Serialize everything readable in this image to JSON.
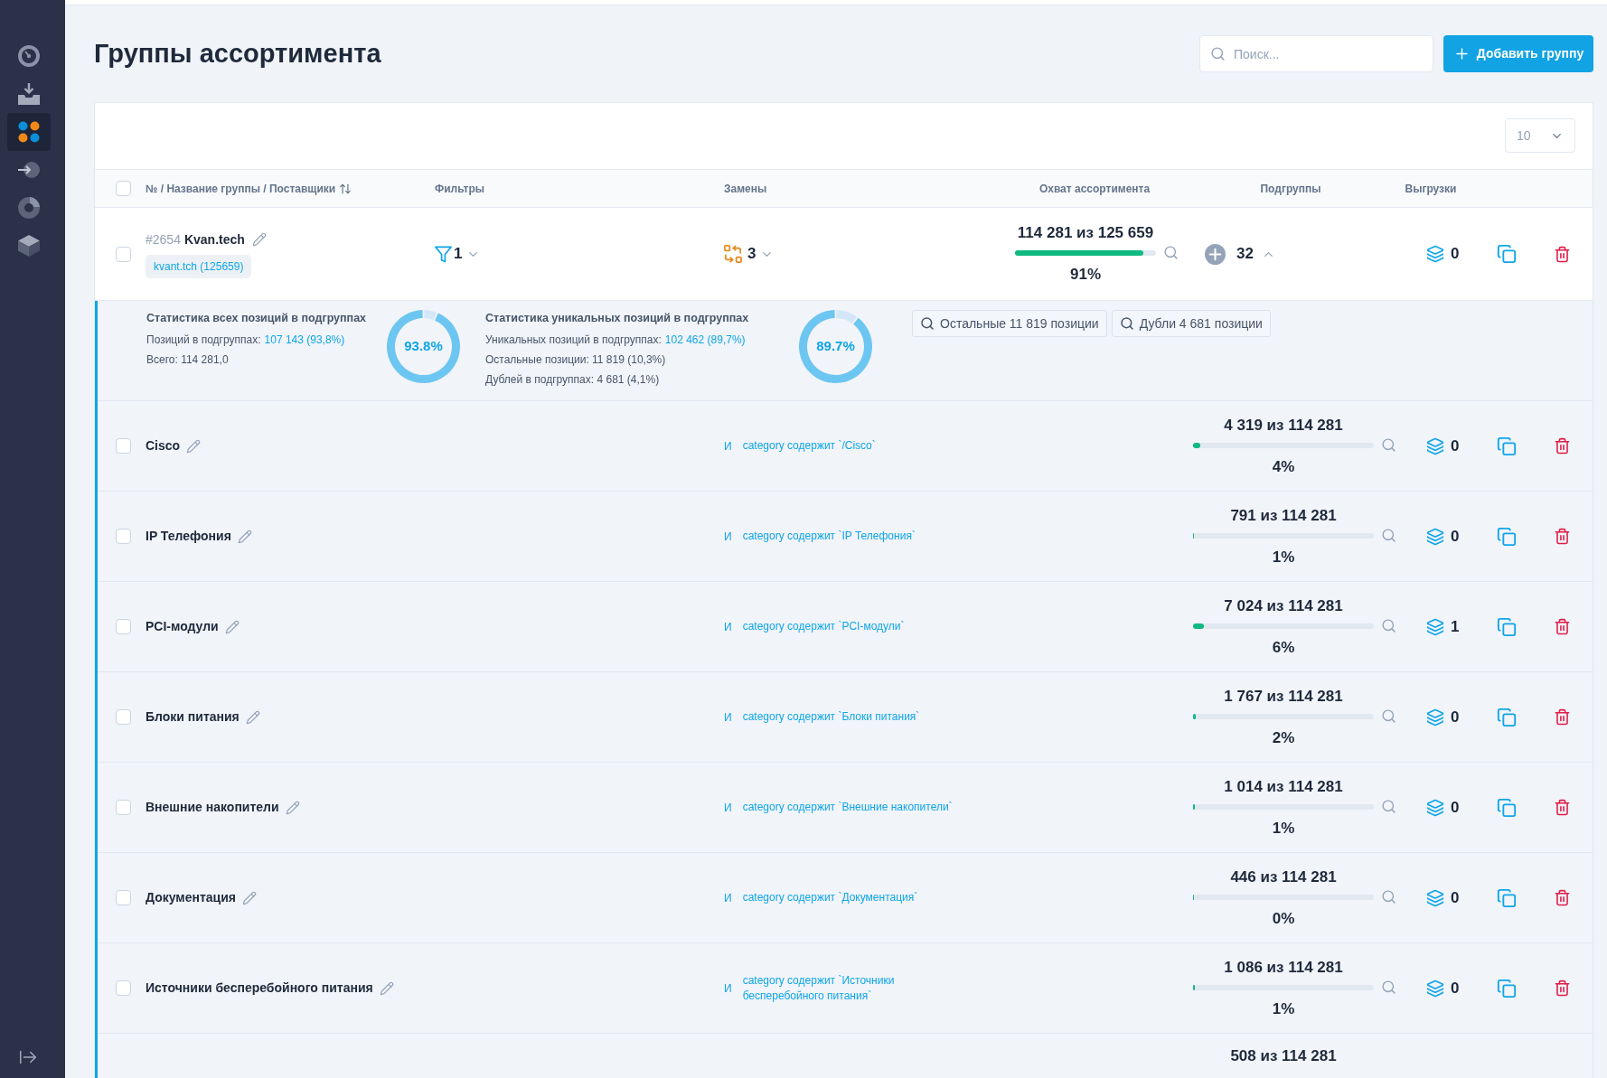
{
  "sidebar": {
    "items": [
      {
        "kind": "gauge",
        "selected": false
      },
      {
        "kind": "inbox",
        "selected": false
      },
      {
        "kind": "dots",
        "selected": true
      },
      {
        "kind": "login",
        "selected": false
      },
      {
        "kind": "pie",
        "selected": false
      },
      {
        "kind": "cube",
        "selected": false
      }
    ]
  },
  "header": {
    "title": "Группы ассортимента",
    "search": {
      "placeholder": "Поиск..."
    },
    "add_button": {
      "label": "Добавить группу"
    }
  },
  "table": {
    "page_size": "10",
    "all_checked": false,
    "columns": [
      {
        "label": "№ / Название группы / Поставщики",
        "sortable": true
      },
      {
        "label": "Фильтры",
        "sortable": false
      },
      {
        "label": "Замены",
        "sortable": false
      },
      {
        "label": "Охват ассортимента",
        "sortable": false
      },
      {
        "label": "Подгруппы",
        "sortable": false
      },
      {
        "label": "Выгрузки",
        "sortable": false
      }
    ],
    "groups": [
      {
        "checked": false,
        "number": "#2654",
        "name": "Kvan.tech",
        "suppliers": [
          "kvant.tch (125659)"
        ],
        "filters": "1",
        "replacements": "3",
        "coverage": {
          "text": "114 281 из 125 659",
          "level": 0.91,
          "percent": "91%"
        },
        "subgroups": {
          "count": "32",
          "expanded": true
        },
        "exports": "0",
        "stats": {
          "blocks": [
            {
              "title": "Статистика всех позиций в подгруппах",
              "lines": [
                {
                  "kind": "link",
                  "label": "Позиций в подгруппах:",
                  "value": "107 143 (93,8%)"
                },
                {
                  "kind": "plain",
                  "text": "Всего: 114 281,0"
                }
              ],
              "ring": {
                "label": "93.8%",
                "chart_data": {
                  "type": "donut",
                  "values": [
                    93.8,
                    6.2
                  ]
                }
              }
            },
            {
              "title": "Статистика уникальных позиций в подгруппах",
              "lines": [
                {
                  "kind": "link",
                  "label": "Уникальных позиций в подгруппах:",
                  "value": "102 462 (89,7%)"
                },
                {
                  "kind": "plain",
                  "text": "Остальные позиции: 11 819 (10,3%)"
                },
                {
                  "kind": "plain",
                  "text": "Дублей в подгруппах: 4 681 (4,1%)"
                }
              ],
              "ring": {
                "label": "89.7%",
                "chart_data": {
                  "type": "donut",
                  "values": [
                    89.7,
                    10.3
                  ]
                }
              }
            }
          ],
          "buttons": [
            "Остальные 11 819 позиции",
            "Дубли 4 681 позиции"
          ]
        },
        "children": [
          {
            "checked": false,
            "name": "Cisco",
            "connector": "И",
            "filter": "category содержит `/Cisco`",
            "coverage": {
              "text": "4 319 из 114 281",
              "level": 0.038,
              "percent": "4%"
            },
            "exports": "0"
          },
          {
            "checked": false,
            "name": "IP Телефония",
            "connector": "И",
            "filter": "category содержит `IP Телефония`",
            "coverage": {
              "text": "791 из 114 281",
              "level": 0.007,
              "percent": "1%"
            },
            "exports": "0"
          },
          {
            "checked": false,
            "name": "PCI-модули",
            "connector": "И",
            "filter": "category содержит `PCI-модули`",
            "coverage": {
              "text": "7 024 из 114 281",
              "level": 0.061,
              "percent": "6%"
            },
            "exports": "1"
          },
          {
            "checked": false,
            "name": "Блоки питания",
            "connector": "И",
            "filter": "category содержит `Блоки питания`",
            "coverage": {
              "text": "1 767 из 114 281",
              "level": 0.015,
              "percent": "2%"
            },
            "exports": "0"
          },
          {
            "checked": false,
            "name": "Внешние накопители",
            "connector": "И",
            "filter": "category содержит `Внешние накопители`",
            "coverage": {
              "text": "1 014 из 114 281",
              "level": 0.009,
              "percent": "1%"
            },
            "exports": "0"
          },
          {
            "checked": false,
            "name": "Документация",
            "connector": "И",
            "filter": "category содержит `Документация`",
            "coverage": {
              "text": "446 из 114 281",
              "level": 0.004,
              "percent": "0%"
            },
            "exports": "0"
          },
          {
            "checked": false,
            "name": "Источники бесперебойного питания",
            "connector": "И",
            "filter": "category содержит `Источники бесперебойного питания`",
            "coverage": {
              "text": "1 086 из 114 281",
              "level": 0.0095,
              "percent": "1%"
            },
            "exports": "0"
          },
          {
            "coverage": {
              "text": "508 из 114 281"
            }
          }
        ]
      }
    ]
  }
}
